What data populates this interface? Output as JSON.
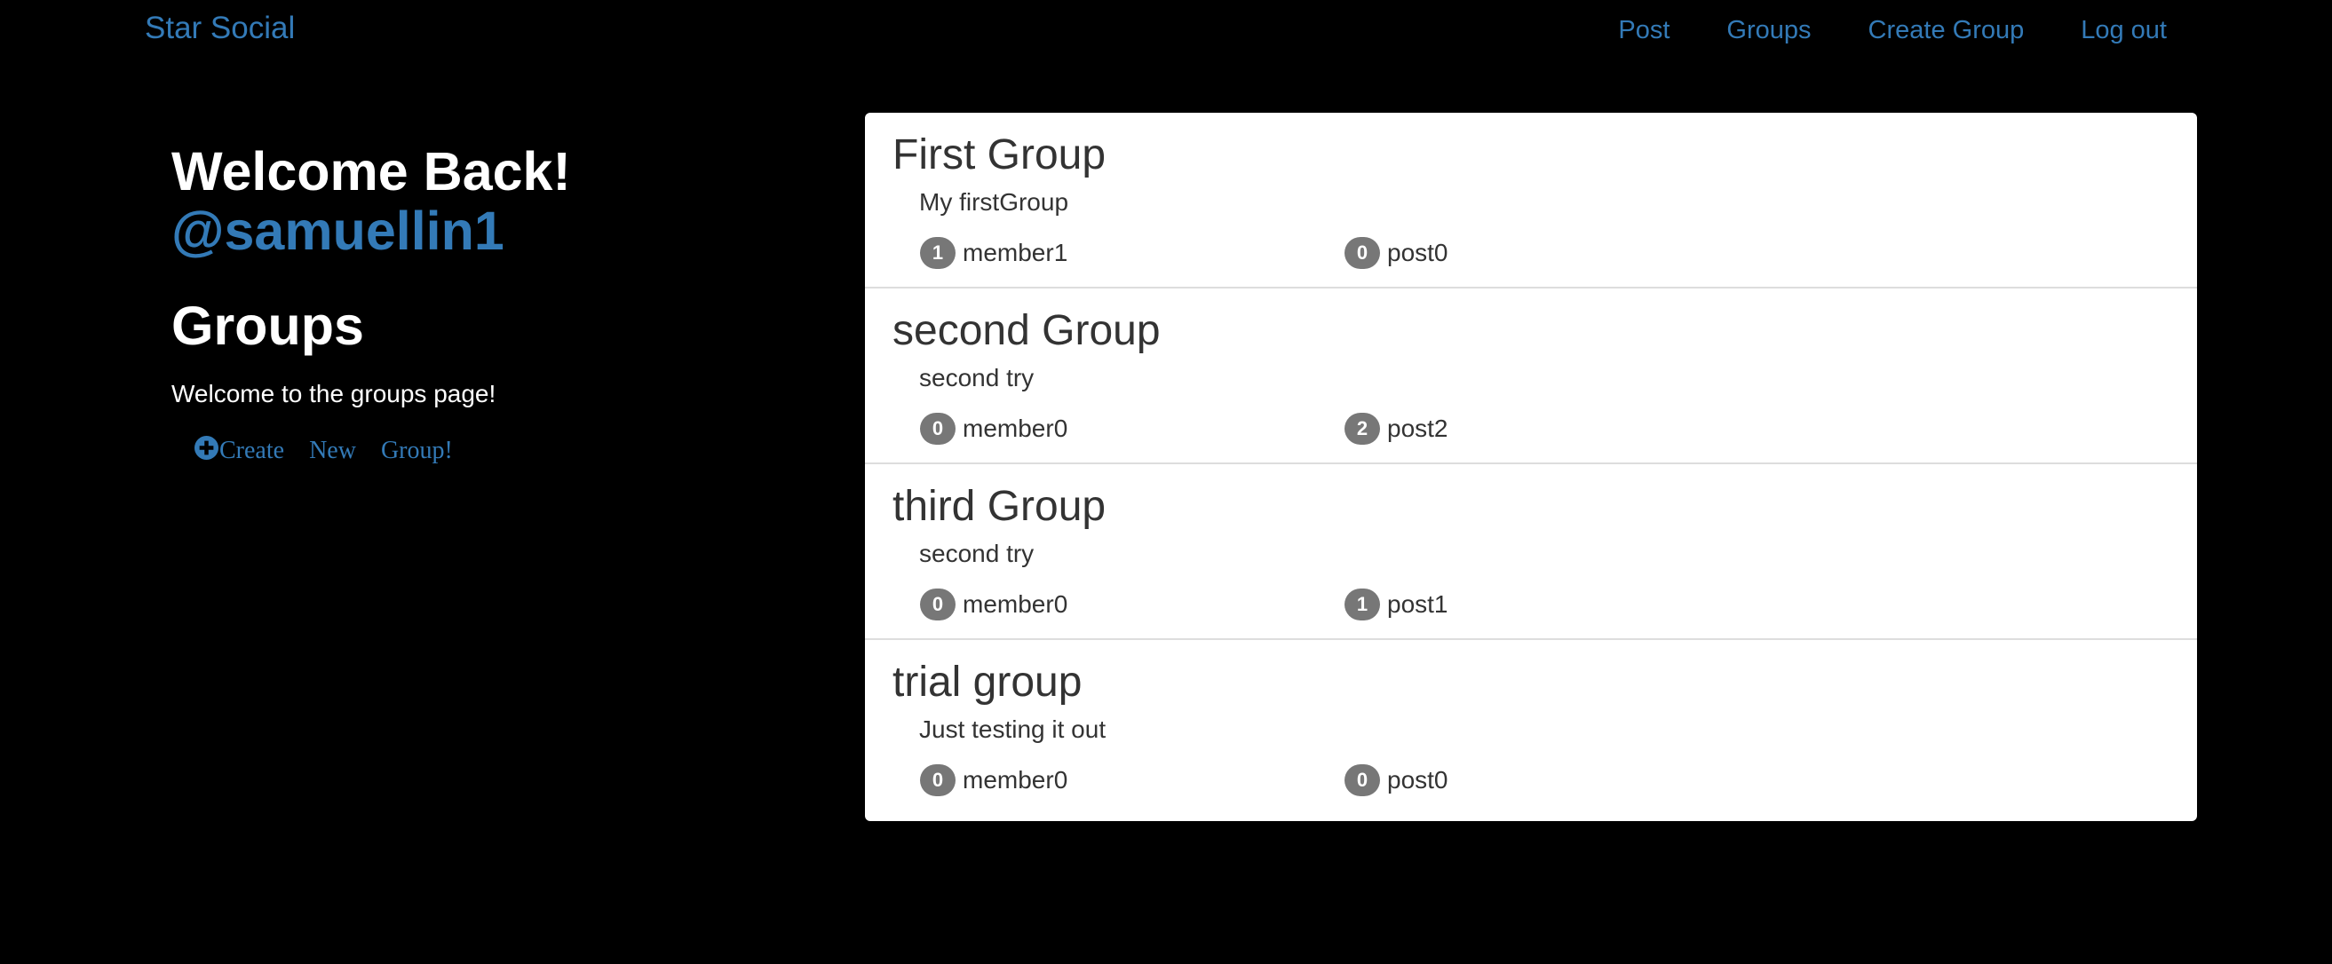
{
  "navbar": {
    "brand": "Star Social",
    "links": [
      "Post",
      "Groups",
      "Create Group",
      "Log out"
    ]
  },
  "sidebar": {
    "welcome": "Welcome Back!",
    "username": "@samuellin1",
    "heading": "Groups",
    "intro": "Welcome to the groups page!",
    "create_words": [
      "Create",
      "New",
      "Group!"
    ],
    "create_icon": "plus-circle-icon"
  },
  "groups": [
    {
      "title": "First Group",
      "description": "My firstGroup",
      "member_count": "1",
      "member_label": "member1",
      "post_count": "0",
      "post_label": "post0"
    },
    {
      "title": "second Group",
      "description": "second try",
      "member_count": "0",
      "member_label": "member0",
      "post_count": "2",
      "post_label": "post2"
    },
    {
      "title": "third Group",
      "description": "second try",
      "member_count": "0",
      "member_label": "member0",
      "post_count": "1",
      "post_label": "post1"
    },
    {
      "title": "trial group",
      "description": "Just testing it out",
      "member_count": "0",
      "member_label": "member0",
      "post_count": "0",
      "post_label": "post0"
    }
  ],
  "colors": {
    "background": "#000000",
    "link": "#337ab7",
    "panel": "#ffffff",
    "text": "#333333",
    "badge": "#777777"
  }
}
